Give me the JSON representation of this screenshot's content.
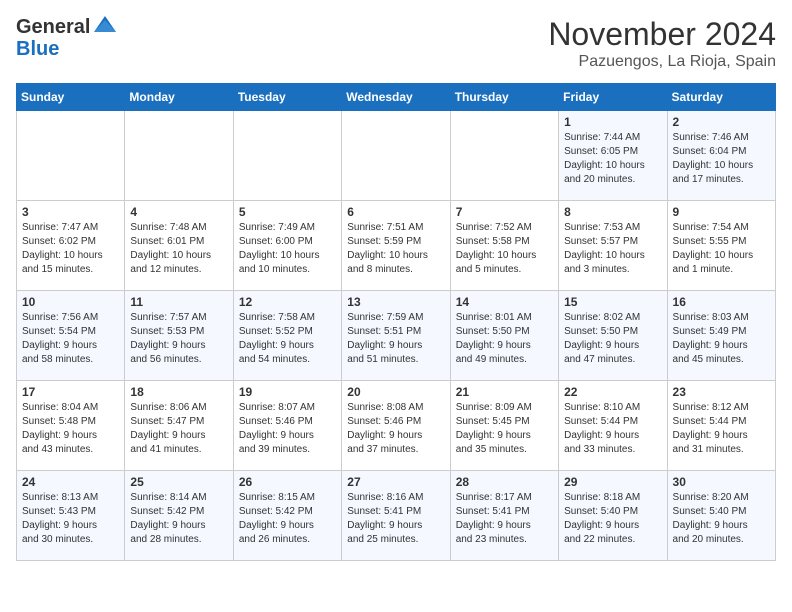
{
  "header": {
    "logo_line1": "General",
    "logo_line2": "Blue",
    "month": "November 2024",
    "location": "Pazuengos, La Rioja, Spain"
  },
  "weekdays": [
    "Sunday",
    "Monday",
    "Tuesday",
    "Wednesday",
    "Thursday",
    "Friday",
    "Saturday"
  ],
  "weeks": [
    [
      {
        "day": "",
        "info": ""
      },
      {
        "day": "",
        "info": ""
      },
      {
        "day": "",
        "info": ""
      },
      {
        "day": "",
        "info": ""
      },
      {
        "day": "",
        "info": ""
      },
      {
        "day": "1",
        "info": "Sunrise: 7:44 AM\nSunset: 6:05 PM\nDaylight: 10 hours\nand 20 minutes."
      },
      {
        "day": "2",
        "info": "Sunrise: 7:46 AM\nSunset: 6:04 PM\nDaylight: 10 hours\nand 17 minutes."
      }
    ],
    [
      {
        "day": "3",
        "info": "Sunrise: 7:47 AM\nSunset: 6:02 PM\nDaylight: 10 hours\nand 15 minutes."
      },
      {
        "day": "4",
        "info": "Sunrise: 7:48 AM\nSunset: 6:01 PM\nDaylight: 10 hours\nand 12 minutes."
      },
      {
        "day": "5",
        "info": "Sunrise: 7:49 AM\nSunset: 6:00 PM\nDaylight: 10 hours\nand 10 minutes."
      },
      {
        "day": "6",
        "info": "Sunrise: 7:51 AM\nSunset: 5:59 PM\nDaylight: 10 hours\nand 8 minutes."
      },
      {
        "day": "7",
        "info": "Sunrise: 7:52 AM\nSunset: 5:58 PM\nDaylight: 10 hours\nand 5 minutes."
      },
      {
        "day": "8",
        "info": "Sunrise: 7:53 AM\nSunset: 5:57 PM\nDaylight: 10 hours\nand 3 minutes."
      },
      {
        "day": "9",
        "info": "Sunrise: 7:54 AM\nSunset: 5:55 PM\nDaylight: 10 hours\nand 1 minute."
      }
    ],
    [
      {
        "day": "10",
        "info": "Sunrise: 7:56 AM\nSunset: 5:54 PM\nDaylight: 9 hours\nand 58 minutes."
      },
      {
        "day": "11",
        "info": "Sunrise: 7:57 AM\nSunset: 5:53 PM\nDaylight: 9 hours\nand 56 minutes."
      },
      {
        "day": "12",
        "info": "Sunrise: 7:58 AM\nSunset: 5:52 PM\nDaylight: 9 hours\nand 54 minutes."
      },
      {
        "day": "13",
        "info": "Sunrise: 7:59 AM\nSunset: 5:51 PM\nDaylight: 9 hours\nand 51 minutes."
      },
      {
        "day": "14",
        "info": "Sunrise: 8:01 AM\nSunset: 5:50 PM\nDaylight: 9 hours\nand 49 minutes."
      },
      {
        "day": "15",
        "info": "Sunrise: 8:02 AM\nSunset: 5:50 PM\nDaylight: 9 hours\nand 47 minutes."
      },
      {
        "day": "16",
        "info": "Sunrise: 8:03 AM\nSunset: 5:49 PM\nDaylight: 9 hours\nand 45 minutes."
      }
    ],
    [
      {
        "day": "17",
        "info": "Sunrise: 8:04 AM\nSunset: 5:48 PM\nDaylight: 9 hours\nand 43 minutes."
      },
      {
        "day": "18",
        "info": "Sunrise: 8:06 AM\nSunset: 5:47 PM\nDaylight: 9 hours\nand 41 minutes."
      },
      {
        "day": "19",
        "info": "Sunrise: 8:07 AM\nSunset: 5:46 PM\nDaylight: 9 hours\nand 39 minutes."
      },
      {
        "day": "20",
        "info": "Sunrise: 8:08 AM\nSunset: 5:46 PM\nDaylight: 9 hours\nand 37 minutes."
      },
      {
        "day": "21",
        "info": "Sunrise: 8:09 AM\nSunset: 5:45 PM\nDaylight: 9 hours\nand 35 minutes."
      },
      {
        "day": "22",
        "info": "Sunrise: 8:10 AM\nSunset: 5:44 PM\nDaylight: 9 hours\nand 33 minutes."
      },
      {
        "day": "23",
        "info": "Sunrise: 8:12 AM\nSunset: 5:44 PM\nDaylight: 9 hours\nand 31 minutes."
      }
    ],
    [
      {
        "day": "24",
        "info": "Sunrise: 8:13 AM\nSunset: 5:43 PM\nDaylight: 9 hours\nand 30 minutes."
      },
      {
        "day": "25",
        "info": "Sunrise: 8:14 AM\nSunset: 5:42 PM\nDaylight: 9 hours\nand 28 minutes."
      },
      {
        "day": "26",
        "info": "Sunrise: 8:15 AM\nSunset: 5:42 PM\nDaylight: 9 hours\nand 26 minutes."
      },
      {
        "day": "27",
        "info": "Sunrise: 8:16 AM\nSunset: 5:41 PM\nDaylight: 9 hours\nand 25 minutes."
      },
      {
        "day": "28",
        "info": "Sunrise: 8:17 AM\nSunset: 5:41 PM\nDaylight: 9 hours\nand 23 minutes."
      },
      {
        "day": "29",
        "info": "Sunrise: 8:18 AM\nSunset: 5:40 PM\nDaylight: 9 hours\nand 22 minutes."
      },
      {
        "day": "30",
        "info": "Sunrise: 8:20 AM\nSunset: 5:40 PM\nDaylight: 9 hours\nand 20 minutes."
      }
    ]
  ]
}
